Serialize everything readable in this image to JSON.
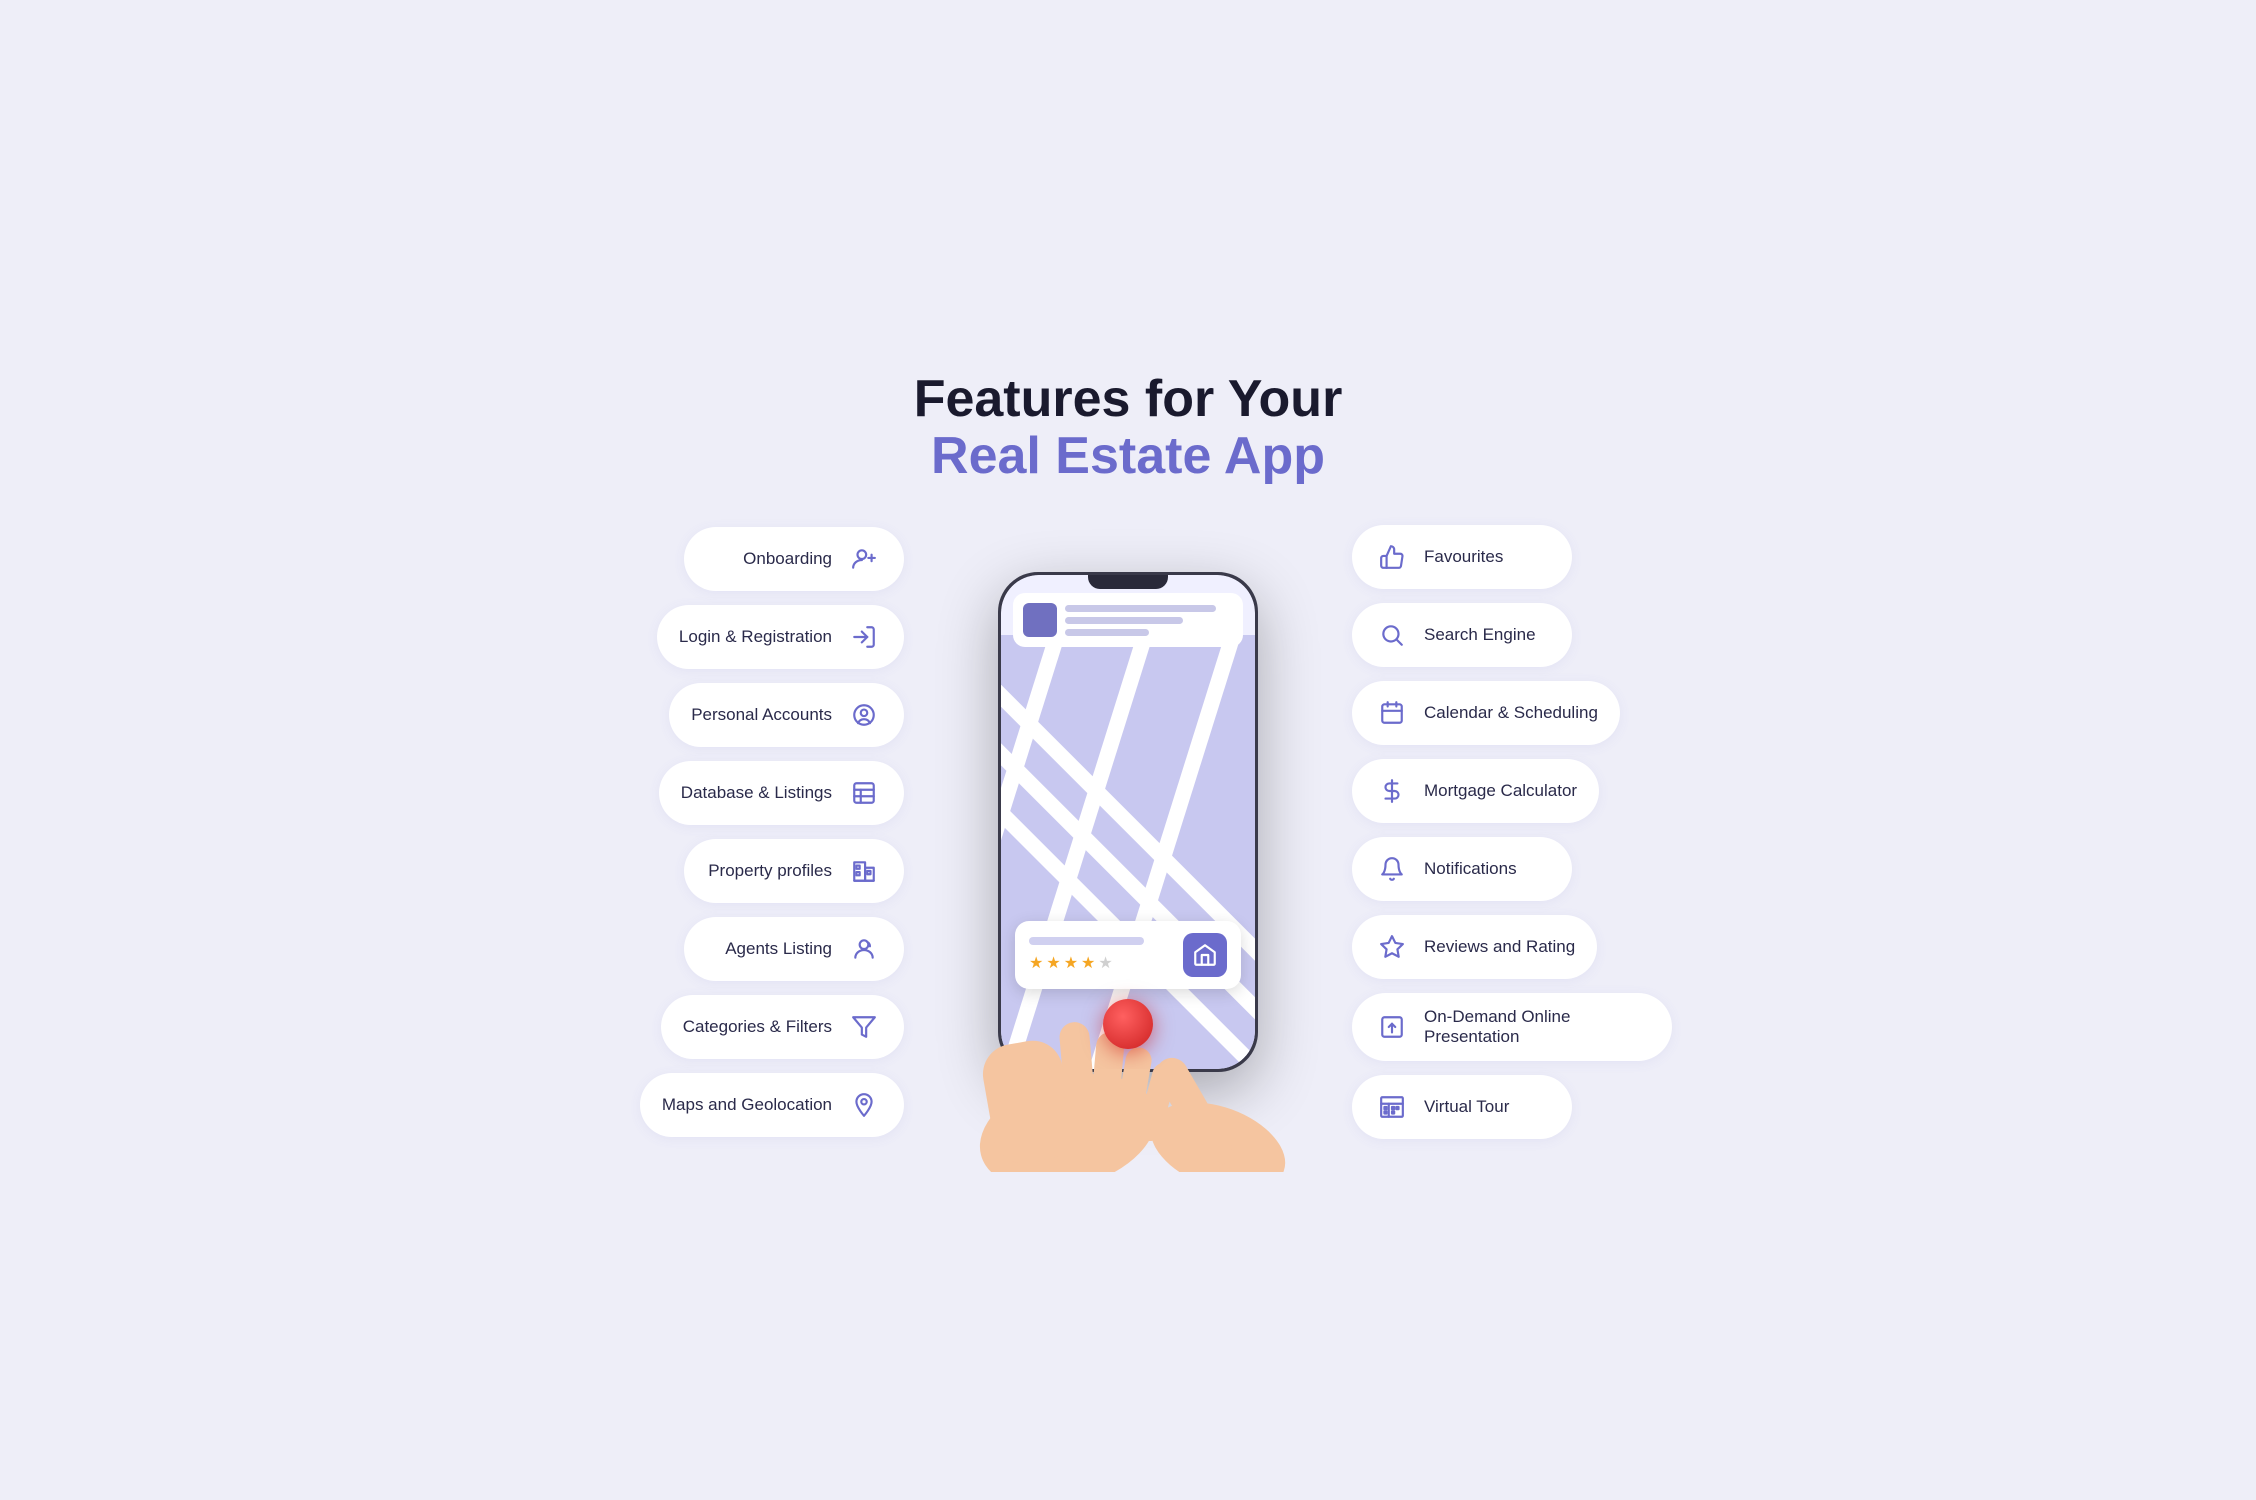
{
  "title": {
    "line1": "Features for Your",
    "line2": "Real Estate App"
  },
  "left_features": [
    {
      "id": "onboarding",
      "label": "Onboarding",
      "icon": "user-plus"
    },
    {
      "id": "login",
      "label": "Login & Registration",
      "icon": "login"
    },
    {
      "id": "personal-accounts",
      "label": "Personal Accounts",
      "icon": "user-circle"
    },
    {
      "id": "database",
      "label": "Database & Listings",
      "icon": "table"
    },
    {
      "id": "property-profiles",
      "label": "Property profiles",
      "icon": "building"
    },
    {
      "id": "agents-listing",
      "label": "Agents Listing",
      "icon": "agent"
    },
    {
      "id": "categories-filters",
      "label": "Categories & Filters",
      "icon": "filter"
    },
    {
      "id": "maps-geolocation",
      "label": "Maps and Geolocation",
      "icon": "pin"
    }
  ],
  "right_features": [
    {
      "id": "favourites",
      "label": "Favourites",
      "icon": "thumbs-up"
    },
    {
      "id": "search-engine",
      "label": "Search Engine",
      "icon": "search"
    },
    {
      "id": "calendar-scheduling",
      "label": "Calendar & Scheduling",
      "icon": "calendar"
    },
    {
      "id": "mortgage-calculator",
      "label": "Mortgage Calculator",
      "icon": "dollar"
    },
    {
      "id": "notifications",
      "label": "Notifications",
      "icon": "bell"
    },
    {
      "id": "reviews-rating",
      "label": "Reviews and Rating",
      "icon": "star"
    },
    {
      "id": "online-presentation",
      "label": "On-Demand Online Presentation",
      "icon": "upload-box"
    },
    {
      "id": "virtual-tour",
      "label": "Virtual Tour",
      "icon": "building-2"
    }
  ],
  "phone": {
    "stars": [
      "filled",
      "filled",
      "filled",
      "filled",
      "empty"
    ]
  }
}
